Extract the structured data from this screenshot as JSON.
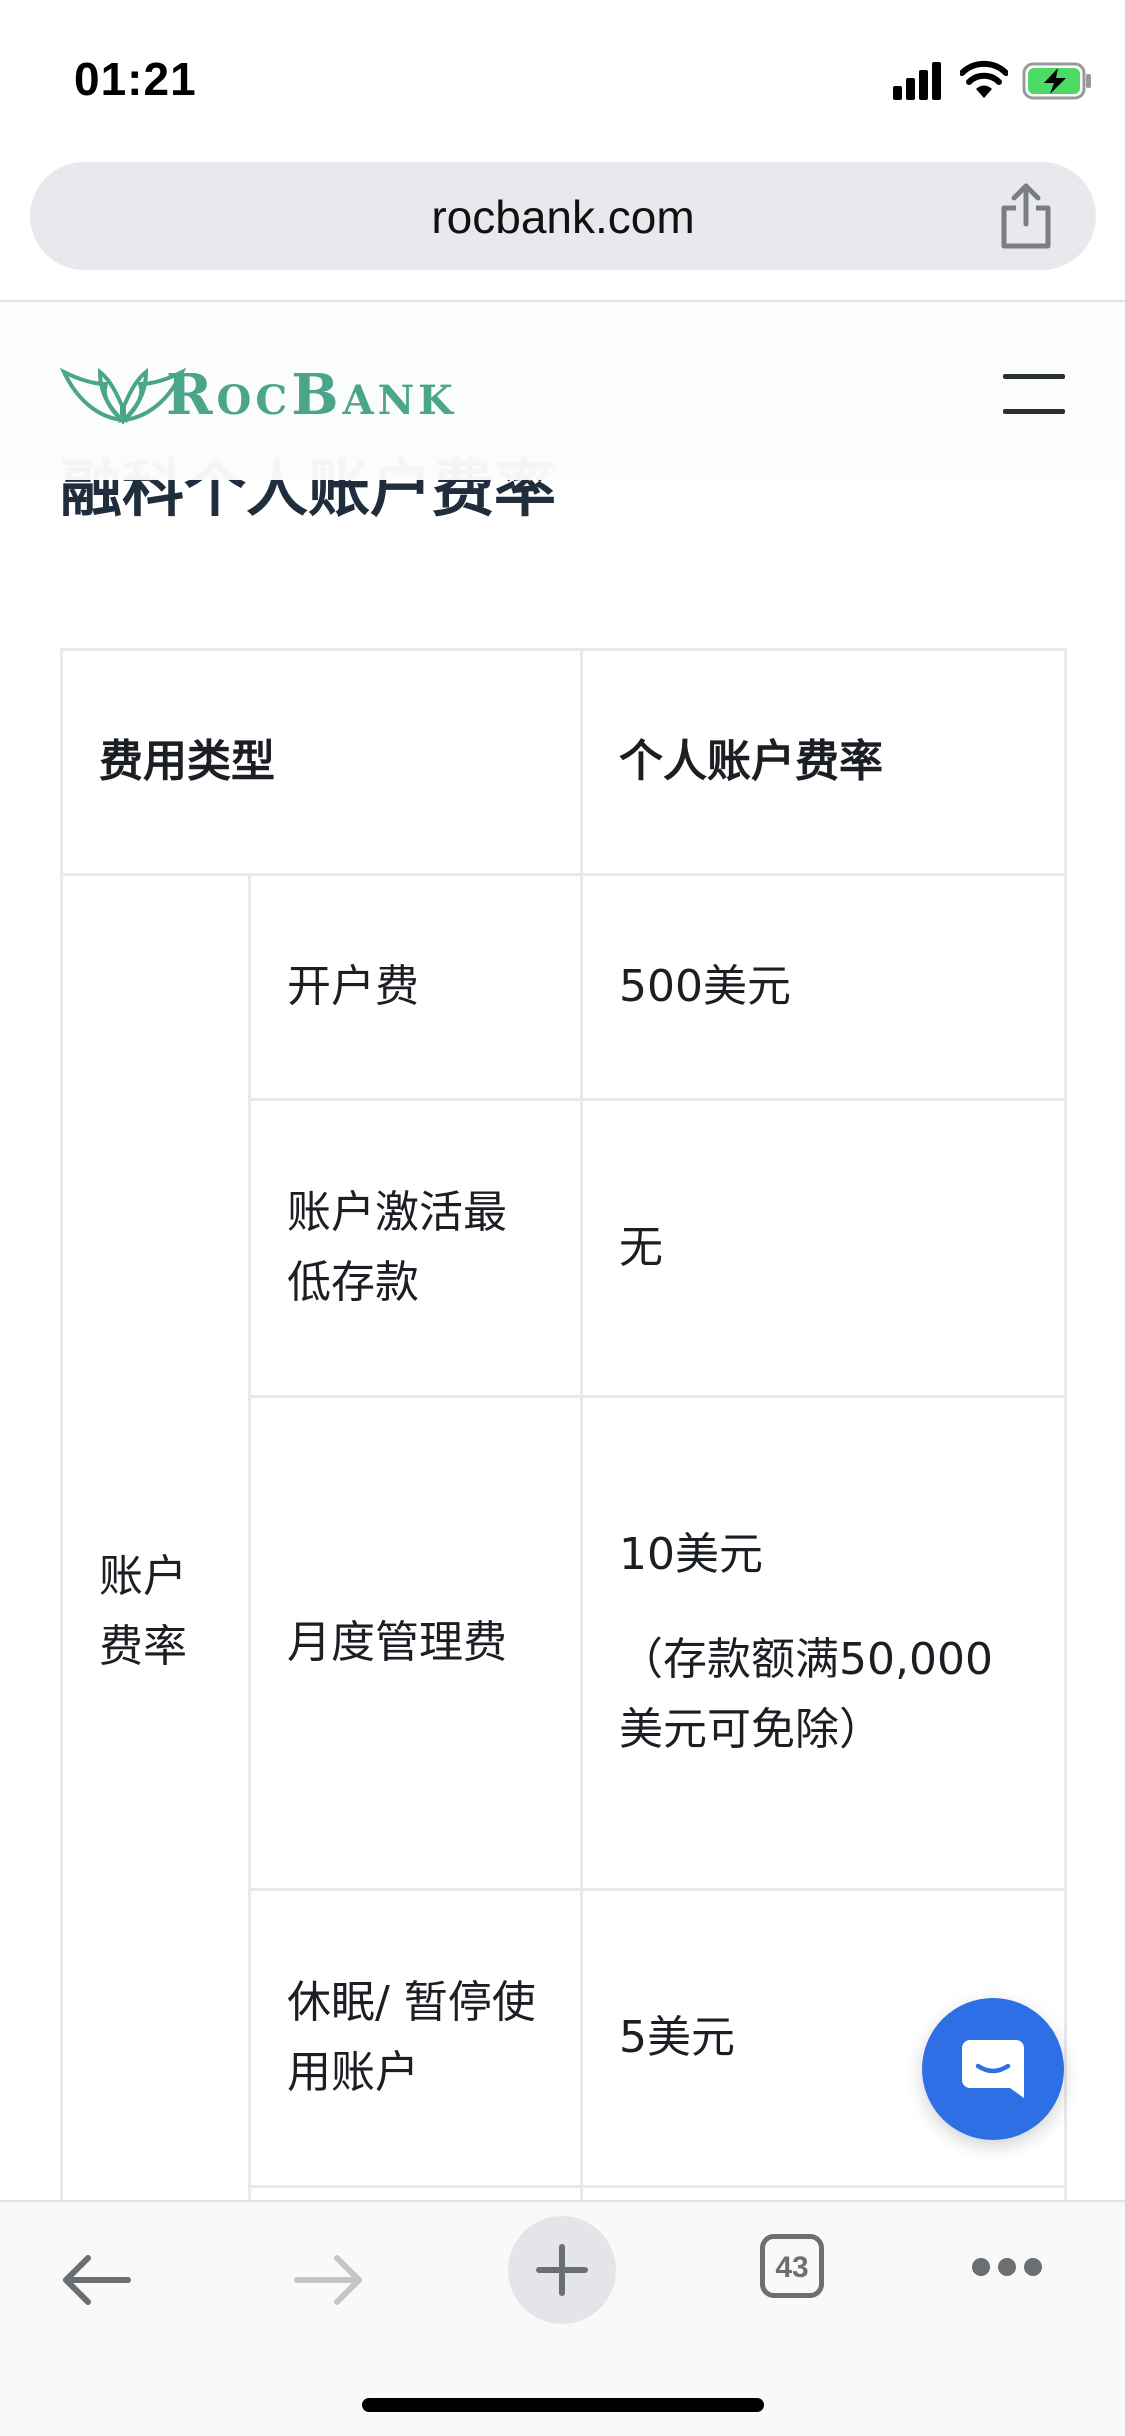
{
  "status_bar": {
    "time": "01:21"
  },
  "browser": {
    "url": "rocbank.com",
    "tab_count": "43"
  },
  "site": {
    "brand": {
      "part1_big": "R",
      "part1_small": "OC",
      "part2_big": "B",
      "part2_small": "ANK"
    },
    "section_title": "融科个人账户费率",
    "colors": {
      "brand": "#4aa58a",
      "chat": "#2f6fe6"
    }
  },
  "table": {
    "header": {
      "fee_type": "费用类型",
      "personal_rate": "个人账户费率"
    },
    "group_label": "账户费率",
    "rows": [
      {
        "item": "开户费",
        "value": "500美元"
      },
      {
        "item": "账户激活最低存款",
        "value": "无"
      },
      {
        "item": "月度管理费",
        "value": "10美元",
        "note": "（存款额满50,000美元可免除）"
      },
      {
        "item": "休眠/ 暂停使用账户",
        "value": "5美元"
      }
    ]
  },
  "icons": {
    "share": "share-icon",
    "menu": "hamburger-menu-icon",
    "chat": "chat-icon",
    "back": "back-arrow-icon",
    "forward": "forward-arrow-icon",
    "new_tab": "plus-icon",
    "more": "more-dots-icon"
  }
}
